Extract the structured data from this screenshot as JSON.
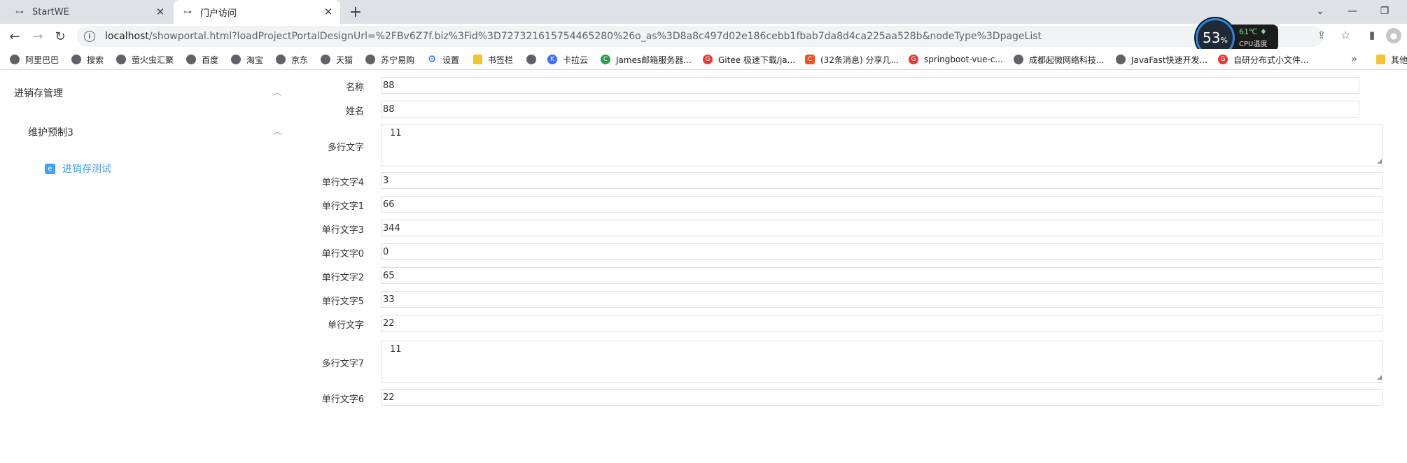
{
  "tabs": [
    {
      "title": "StartWE",
      "active": false
    },
    {
      "title": "门户访问",
      "active": true
    }
  ],
  "address": {
    "host": "localhost",
    "path": "/showportal.html?loadProjectPortalDesignUrl=%2FBv6Z7f.biz%3Fid%3D727321615754465280%26o_as%3D8a8c497d02e186cebb1fbab7da8d4ca225aa528b&nodeType%3DpageList"
  },
  "cpu": {
    "percent": "53",
    "percent_unit": "%",
    "temp": "61℃",
    "label": "CPU温度"
  },
  "bookmarks": [
    {
      "label": "阿里巴巴",
      "icon": "globe-icon"
    },
    {
      "label": "搜索",
      "icon": "globe-icon"
    },
    {
      "label": "萤火虫汇聚",
      "icon": "globe-icon"
    },
    {
      "label": "百度",
      "icon": "globe-icon"
    },
    {
      "label": "淘宝",
      "icon": "globe-icon"
    },
    {
      "label": "京东",
      "icon": "globe-icon"
    },
    {
      "label": "天猫",
      "icon": "globe-icon"
    },
    {
      "label": "苏宁易购",
      "icon": "globe-icon"
    },
    {
      "label": "设置",
      "icon": "gear-icon"
    },
    {
      "label": "书签栏",
      "icon": "folder-icon"
    },
    {
      "label": "",
      "icon": "globe-icon"
    },
    {
      "label": "卡拉云",
      "icon": "kalayun-icon"
    },
    {
      "label": "James邮箱服务器...",
      "icon": "green-c-icon"
    },
    {
      "label": "Gitee 极速下载/ja...",
      "icon": "gitee-icon"
    },
    {
      "label": "(32条消息) 分享几...",
      "icon": "csdn-icon"
    },
    {
      "label": "springboot-vue-c...",
      "icon": "gitee-icon"
    },
    {
      "label": "成都起微网络科技...",
      "icon": "globe-icon"
    },
    {
      "label": "JavaFast快速开发...",
      "icon": "globe-icon"
    },
    {
      "label": "自研分布式小文件...",
      "icon": "gitee-icon"
    },
    {
      "label": "其他",
      "icon": "folder-icon"
    }
  ],
  "sidebar": {
    "group": "进销存管理",
    "subgroup": "维护预制3",
    "leaf": "进销存测试"
  },
  "form": {
    "fields": [
      {
        "label": "名称",
        "value": "88"
      },
      {
        "label": "姓名",
        "value": "88"
      },
      {
        "label": "多行文字",
        "value": "11"
      },
      {
        "label": "单行文字4",
        "value": "3"
      },
      {
        "label": "单行文字1",
        "value": "66"
      },
      {
        "label": "单行文字3",
        "value": "344"
      },
      {
        "label": "单行文字0",
        "value": "0"
      },
      {
        "label": "单行文字2",
        "value": "65"
      },
      {
        "label": "单行文字5",
        "value": "33"
      },
      {
        "label": "单行文字",
        "value": "22"
      },
      {
        "label": "多行文字7",
        "value": "11"
      },
      {
        "label": "单行文字6",
        "value": "22"
      }
    ]
  }
}
